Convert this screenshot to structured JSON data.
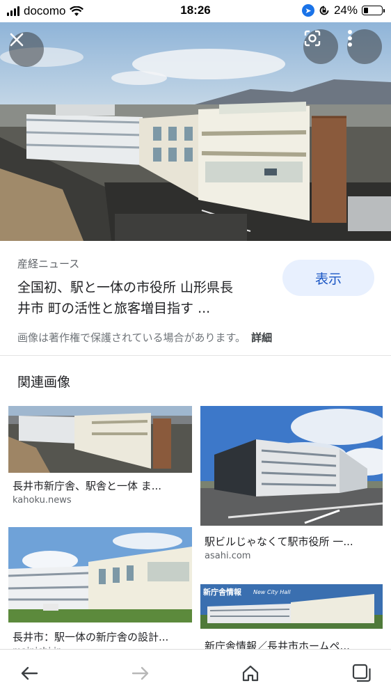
{
  "status_bar": {
    "carrier": "docomo",
    "time": "18:26",
    "battery": "24%"
  },
  "hero": {
    "close_icon": "close-icon",
    "lens_icon": "lens-icon",
    "more_icon": "more-vert-icon"
  },
  "result": {
    "source": "産経ニュース",
    "title_line1": "全国初、駅と一体の市役所 山形県長",
    "title_line2": "井市 町の活性と旅客増目指す ...",
    "view_button": "表示",
    "copyright_notice": "画像は著作権で保護されている場合があります。",
    "details_link": "詳細"
  },
  "related": {
    "heading": "関連画像",
    "items": [
      {
        "title": "長井市新庁舎、駅舎と一体 ま...",
        "source": "kahoku.news"
      },
      {
        "title": "駅ビルじゃなくて駅市役所 一...",
        "source": "asahi.com"
      },
      {
        "title": "長井市：駅一体の新庁舎の設計...",
        "source": "mainichi.jp"
      },
      {
        "title": "新庁舎情報／長井市ホームペ...",
        "source": ""
      }
    ],
    "banner_text": "新庁舎情報",
    "banner_subtext": "New City Hall"
  },
  "nav": {
    "back_icon": "back-arrow-icon",
    "forward_icon": "forward-arrow-icon",
    "home_icon": "home-icon",
    "tabs_icon": "tabs-icon"
  },
  "colors": {
    "accent": "#1a73e8",
    "view_button_bg": "#e8f0fe",
    "view_button_text": "#1a56c4"
  }
}
